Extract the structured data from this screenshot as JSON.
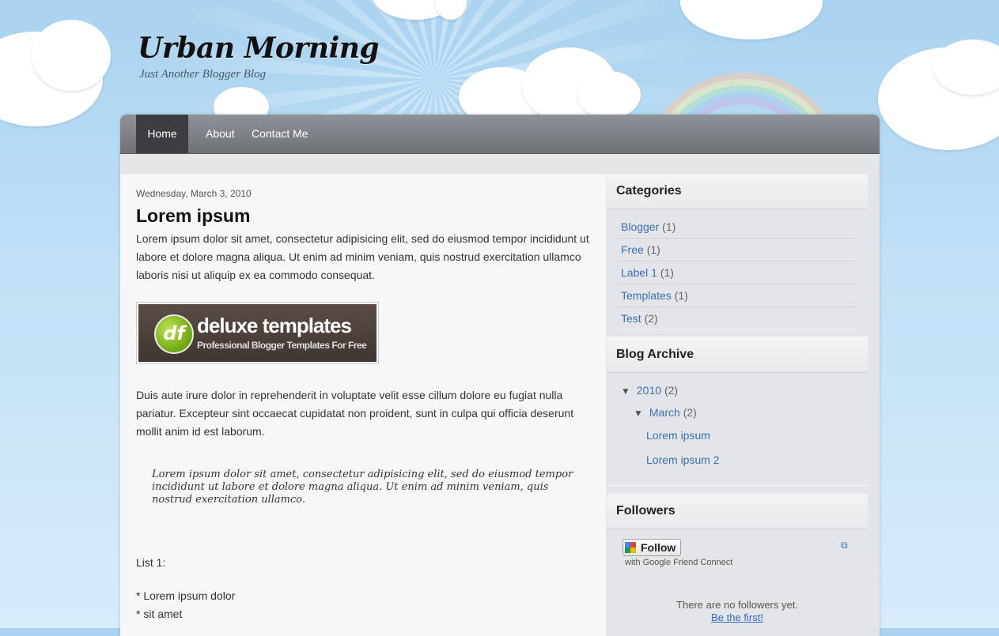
{
  "blog": {
    "title": "Urban Morning",
    "description": "Just Another Blogger Blog"
  },
  "nav": {
    "home": "Home",
    "about": "About",
    "contact": "Contact Me"
  },
  "post": {
    "date": "Wednesday, March 3, 2010",
    "title": "Lorem ipsum",
    "paragraph1": "Lorem ipsum dolor sit amet, consectetur adipisicing elit, sed do eiusmod tempor incididunt ut labore et dolore magna aliqua. Ut enim ad minim veniam, quis nostrud exercitation ullamco laboris nisi ut aliquip ex ea commodo consequat.",
    "banner": {
      "title": "deluxe templates",
      "subtitle": "Professional Blogger Templates For Free",
      "logo": "df"
    },
    "paragraph2": "Duis aute irure dolor in reprehenderit in voluptate velit esse cillum dolore eu fugiat nulla pariatur. Excepteur sint occaecat cupidatat non proident, sunt in culpa qui officia deserunt mollit anim id est laborum.",
    "quote": "Lorem ipsum dolor sit amet, consectetur adipisicing elit, sed do eiusmod tempor incididunt ut labore et dolore magna aliqua. Ut enim ad minim veniam, quis nostrud exercitation ullamco.",
    "list_title": "List 1:",
    "list_items": [
      "* Lorem ipsum dolor",
      "* sit amet"
    ]
  },
  "sidebar": {
    "categories": {
      "heading": "Categories",
      "items": [
        {
          "label": "Blogger",
          "count": "(1)"
        },
        {
          "label": "Free",
          "count": "(1)"
        },
        {
          "label": "Label 1",
          "count": "(1)"
        },
        {
          "label": "Templates",
          "count": "(1)"
        },
        {
          "label": "Test",
          "count": "(2)"
        }
      ]
    },
    "archive": {
      "heading": "Blog Archive",
      "year": {
        "label": "2010",
        "count": "(2)"
      },
      "month": {
        "label": "March",
        "count": "(2)"
      },
      "posts": [
        "Lorem ipsum",
        "Lorem ipsum 2"
      ]
    },
    "followers": {
      "heading": "Followers",
      "follow_label": "Follow",
      "gfc_text": "with Google Friend Connect",
      "empty_text": "There are no followers yet.",
      "be_first": "Be the first!"
    }
  },
  "colors": {
    "link": "#3a6fb5",
    "nav_bg": "#7c8085",
    "nav_active": "#3b3d40"
  }
}
